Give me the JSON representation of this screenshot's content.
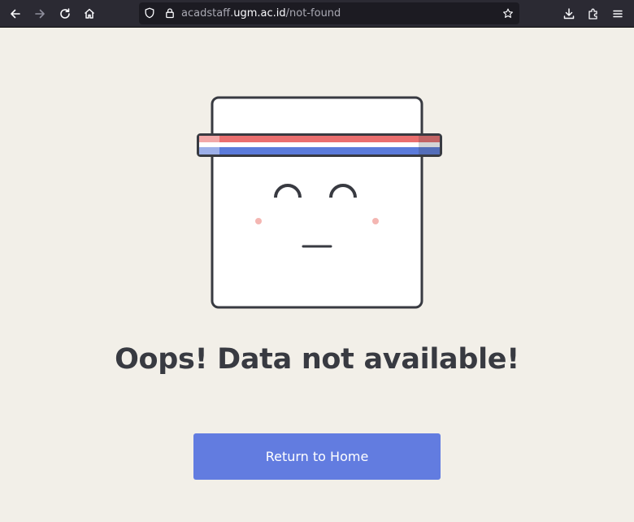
{
  "browser": {
    "url_prefix": "acadstaff.",
    "url_domain": "ugm.ac.id",
    "url_path": "/not-found",
    "icons": {
      "back": "back-arrow-icon",
      "forward": "forward-arrow-icon",
      "reload": "reload-icon",
      "home": "home-icon",
      "shield": "shield-icon",
      "lock": "lock-icon",
      "bookmark": "star-icon",
      "downloads": "download-icon",
      "extensions": "puzzle-icon",
      "menu": "hamburger-menu-icon"
    }
  },
  "page": {
    "heading": "Oops! Data not available!",
    "button_label": "Return to Home",
    "colors": {
      "background": "#f2efe8",
      "button": "#627ce0",
      "text": "#383a41",
      "headband_red": "#ea6f6f",
      "headband_blue": "#5b7bdb",
      "blush": "#f4b6b2"
    },
    "illustration": "sleepy-square-face-with-headband"
  }
}
